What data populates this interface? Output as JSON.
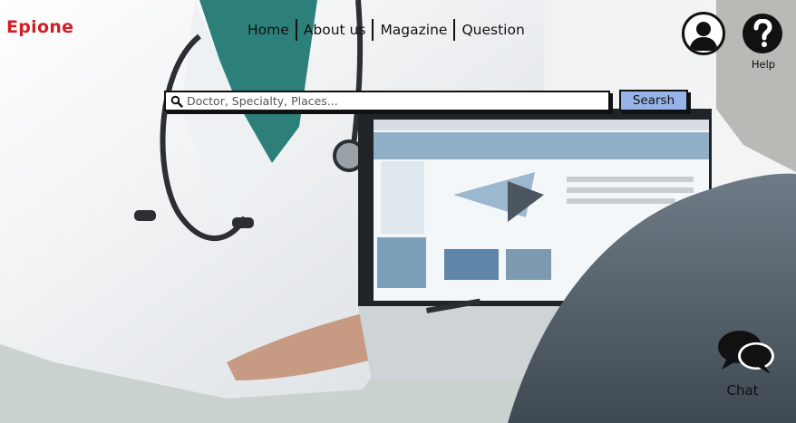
{
  "brand": {
    "name": "Epione",
    "color": "#d01f25"
  },
  "nav": {
    "items": [
      {
        "label": "Home"
      },
      {
        "label": "About us"
      },
      {
        "label": "Magazine"
      },
      {
        "label": "Question"
      }
    ]
  },
  "header": {
    "account_icon": "user-circle-icon",
    "help_icon": "question-circle-icon",
    "help_label": "Help"
  },
  "search": {
    "placeholder": "Doctor, Specialty, Places...",
    "value": "",
    "button_label": "Searsh",
    "button_color": "#97b4e8"
  },
  "chat": {
    "icon": "chat-bubbles-icon",
    "label": "Chat"
  },
  "hero": {
    "description_image": "doctor-with-laptop-photo"
  }
}
